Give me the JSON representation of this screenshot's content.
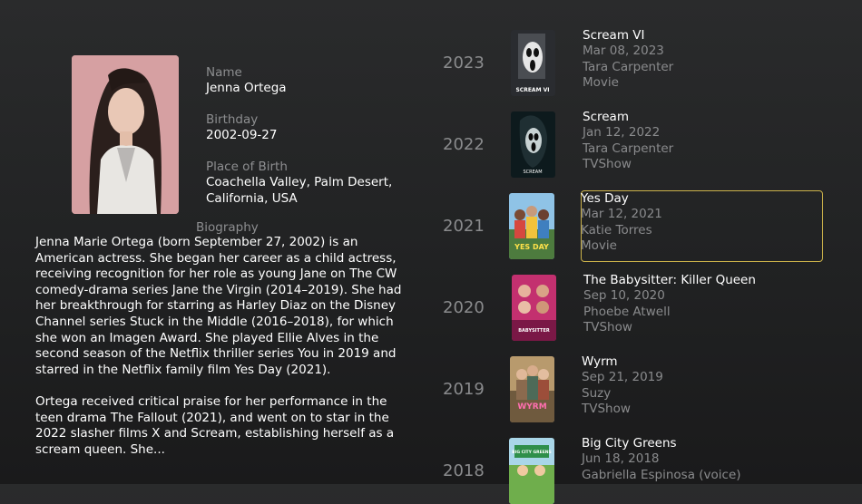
{
  "person": {
    "name_label": "Name",
    "name": "Jenna Ortega",
    "birthday_label": "Birthday",
    "birthday": "2002-09-27",
    "birthplace_label": "Place of Birth",
    "birthplace": "Coachella Valley, Palm Desert, California, USA",
    "biography_label": "Biography",
    "bio_p1": "Jenna Marie Ortega (born September 27, 2002) is an American actress. She began her career as a child actress, receiving recognition for her role as young Jane on The CW comedy-drama series Jane the Virgin (2014–2019). She had her breakthrough for starring as Harley Diaz on the Disney Channel series Stuck in the Middle (2016–2018), for which she won an Imagen Award. She played Ellie Alves in the second season of the Netflix thriller series You in 2019 and starred in the Netflix family film Yes Day (2021).",
    "bio_p2": "Ortega received critical praise for her performance in the teen drama The Fallout (2021), and went on to star in the 2022 slasher films X and Scream, establishing herself as a scream queen. She..."
  },
  "filmography": [
    {
      "year": "2023",
      "title": "Scream VI",
      "date": "Mar 08, 2023",
      "role": "Tara Carpenter",
      "kind": "Movie",
      "poster_text": "SCREAM VI",
      "poster_icon": "ghostface-icon"
    },
    {
      "year": "2022",
      "title": "Scream",
      "date": "Jan 12, 2022",
      "role": "Tara Carpenter",
      "kind": "TVShow",
      "poster_text": "SCREAM",
      "poster_icon": "ghostface-icon"
    },
    {
      "year": "2021",
      "title": "Yes Day",
      "date": "Mar 12, 2021",
      "role": "Katie Torres",
      "kind": "Movie",
      "poster_text": "YES DAY",
      "poster_icon": "family-icon"
    },
    {
      "year": "2020",
      "title": "The Babysitter: Killer Queen",
      "date": "Sep 10, 2020",
      "role": "Phoebe Atwell",
      "kind": "TVShow",
      "poster_text": "BABYSITTER",
      "poster_icon": "faces-icon"
    },
    {
      "year": "2019",
      "title": "Wyrm",
      "date": "Sep 21, 2019",
      "role": "Suzy",
      "kind": "TVShow",
      "poster_text": "WYRM",
      "poster_icon": "people-icon"
    },
    {
      "year": "2018",
      "title": "Big City Greens",
      "date": "Jun 18, 2018",
      "role": "Gabriella Espinosa (voice)",
      "kind": "",
      "poster_text": "BIG CITY GREENS",
      "poster_icon": "cartoon-icon"
    }
  ],
  "colors": {
    "background": "#232425",
    "focus_border": "#cbb24a",
    "secondary_text": "#8a8b8d"
  }
}
